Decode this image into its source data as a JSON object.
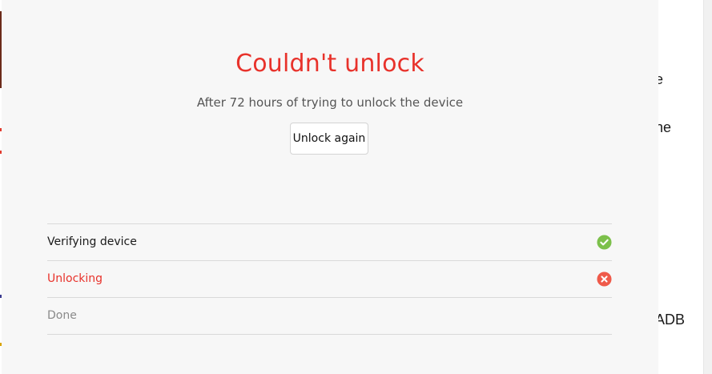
{
  "dialog": {
    "title": "Couldn't unlock",
    "subtitle": "After 72 hours of trying to unlock the device",
    "button_label": "Unlock again",
    "colors": {
      "error": "#e8322b",
      "success": "#7cc04b",
      "failure_icon": "#ef5a4a",
      "pending_text": "#8a8a8a"
    }
  },
  "steps": [
    {
      "label": "Verifying device",
      "status": "success",
      "icon": "check-circle-icon"
    },
    {
      "label": "Unlocking",
      "status": "failed",
      "icon": "x-circle-icon"
    },
    {
      "label": "Done",
      "status": "pending",
      "icon": ""
    }
  ],
  "background": {
    "fragments": [
      "e",
      "ne",
      "ADB"
    ]
  }
}
